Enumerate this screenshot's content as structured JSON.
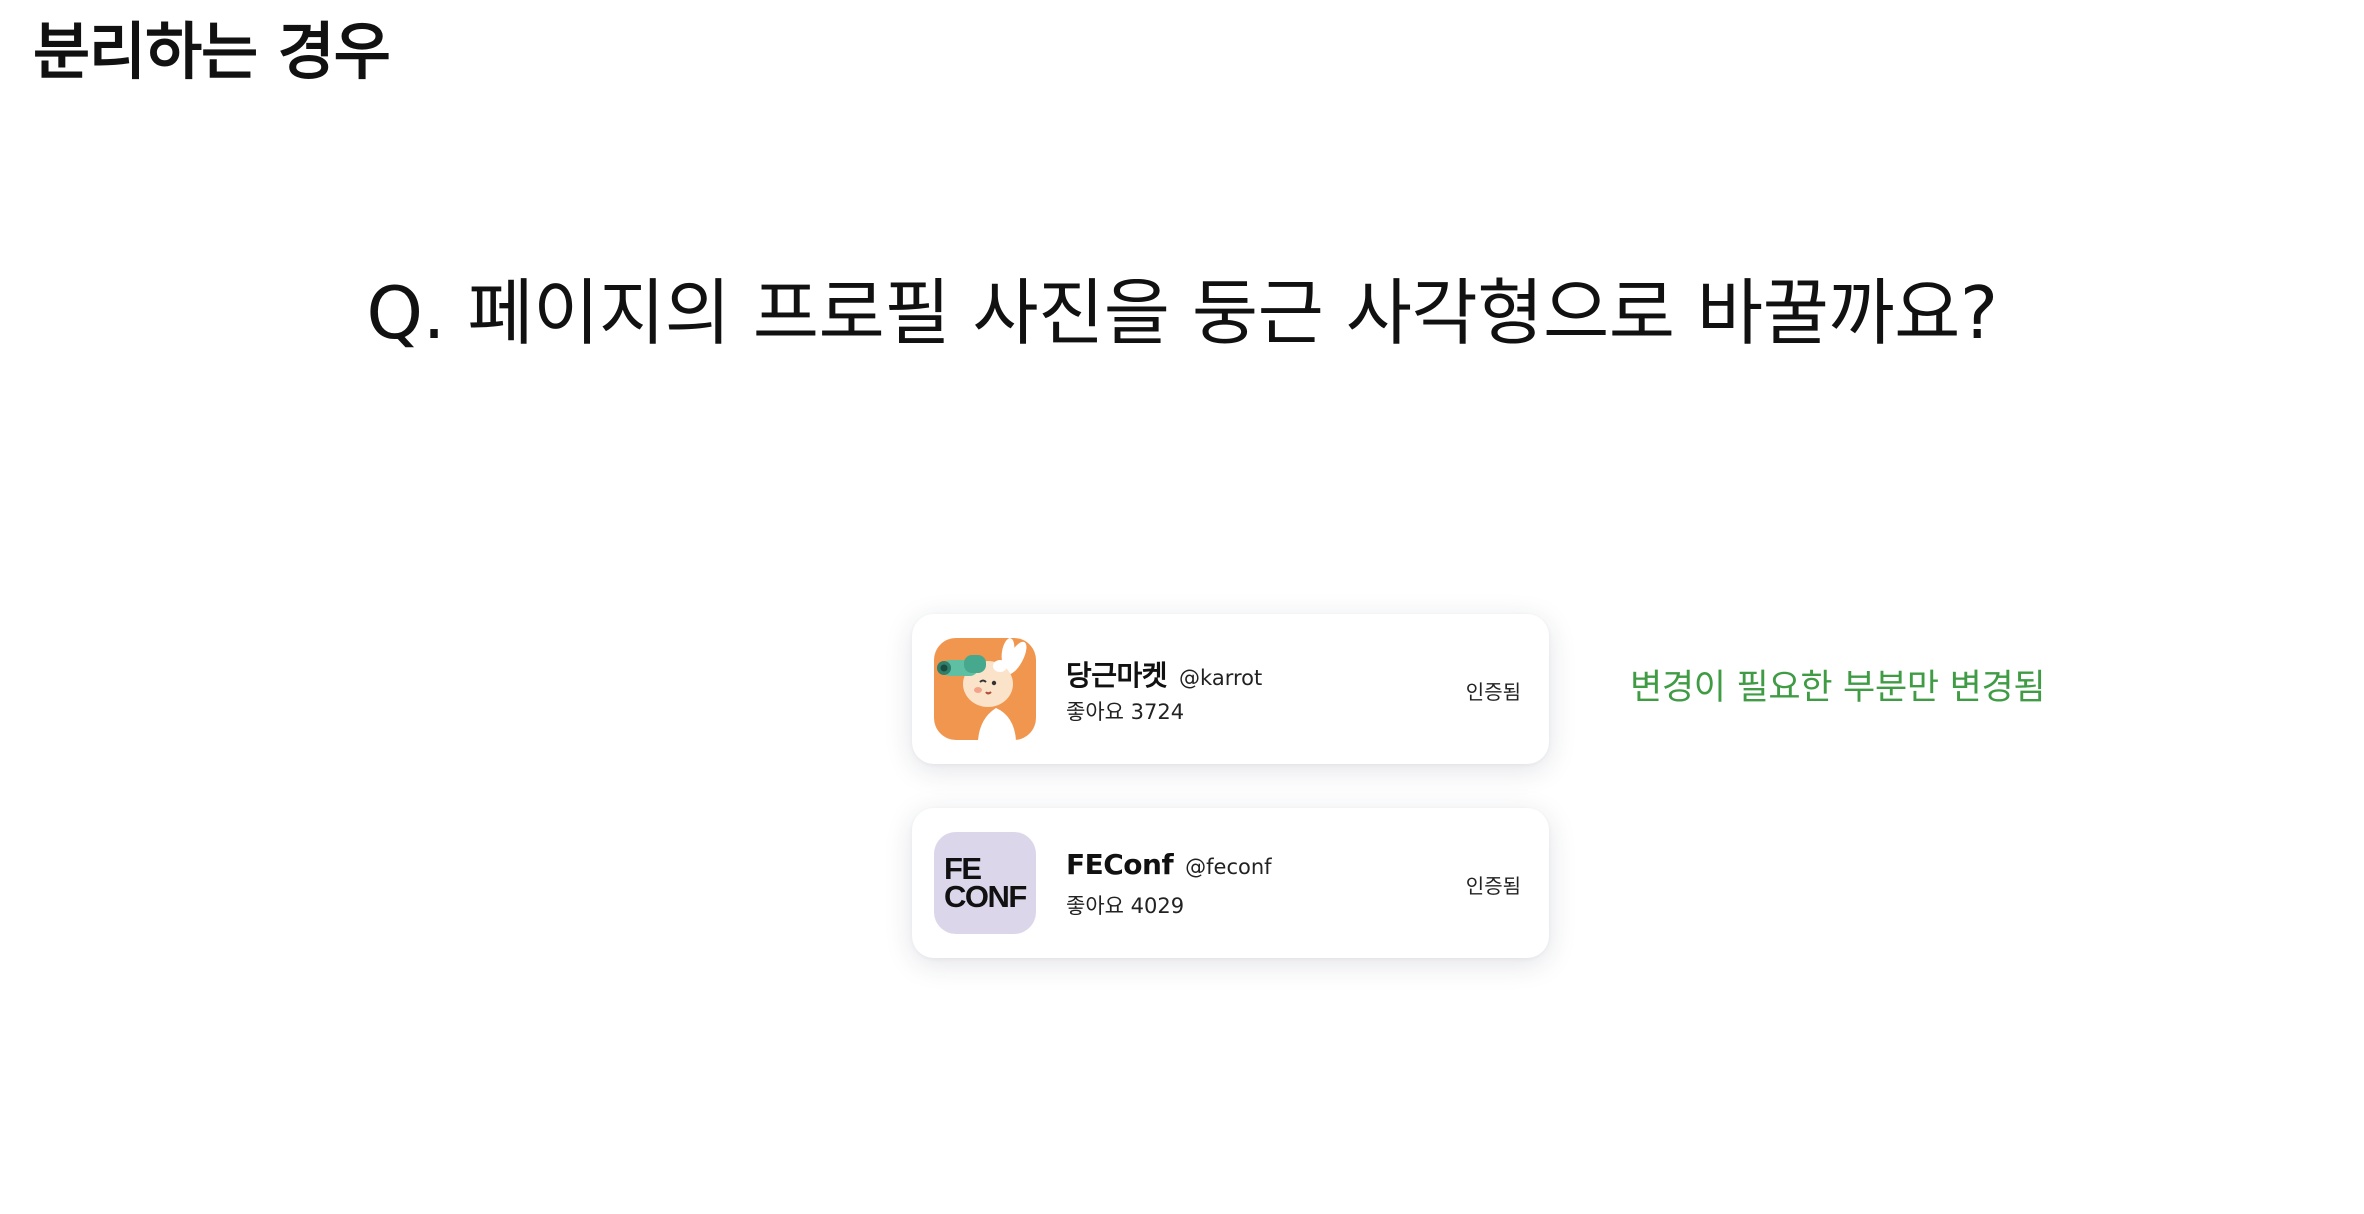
{
  "slide": {
    "title": "분리하는 경우",
    "question": "Q. 페이지의 프로필 사진을 둥근 사각형으로 바꿀까요?"
  },
  "cards": [
    {
      "name": "당근마켓",
      "handle": "@karrot",
      "likes": "좋아요 3724",
      "status": "인증됨",
      "avatar_icon": "karrot-bunny-logo-icon"
    },
    {
      "name": "FEConf",
      "handle": "@feconf",
      "likes": "좋아요 4029",
      "status": "인증됨",
      "avatar_icon": "feconf-logo-icon",
      "logo_lines": [
        "FE",
        "CONF"
      ]
    }
  ],
  "annotation": {
    "text": "변경이 필요한 부분만 변경됨",
    "color": "#3f9b44"
  },
  "colors": {
    "karrot_orange": "#f0964f",
    "feconf_lavender": "#dcd6ea"
  }
}
